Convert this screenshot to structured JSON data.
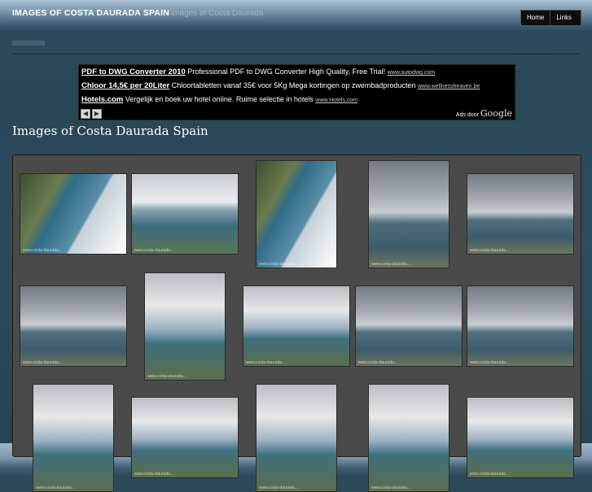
{
  "site": {
    "title": "IMAGES OF COSTA DAURADA SPAIN",
    "subtitle": "images of Costa Daurada"
  },
  "nav": {
    "items": [
      "Home",
      "Links"
    ]
  },
  "ads": {
    "items": [
      {
        "title": "PDF to DWG Converter 2010",
        "text": "Professional PDF to DWG Converter High Quality, Free Trial!",
        "url": "www.autodwg.com"
      },
      {
        "title": "Chloor 14,5€ per 20Liter",
        "text": "Chloortabletten vanaf 35€ voor 5Kg Mega kortingen op zwembadproducten",
        "url": "www.wellnessheaven.be"
      },
      {
        "title": "Hotels.com",
        "text": "Vergelijk en boek uw hotel online. Ruime selectie in hotels",
        "url": "www.Hotels.com"
      }
    ],
    "prev_glyph": "◀",
    "next_glyph": "▶",
    "ads_by": "Ads door",
    "google": "Google"
  },
  "page": {
    "title": "Images of Costa Daurada Spain"
  },
  "gallery": {
    "caption": "www.costa-daurada...",
    "thumbnails": 15
  }
}
